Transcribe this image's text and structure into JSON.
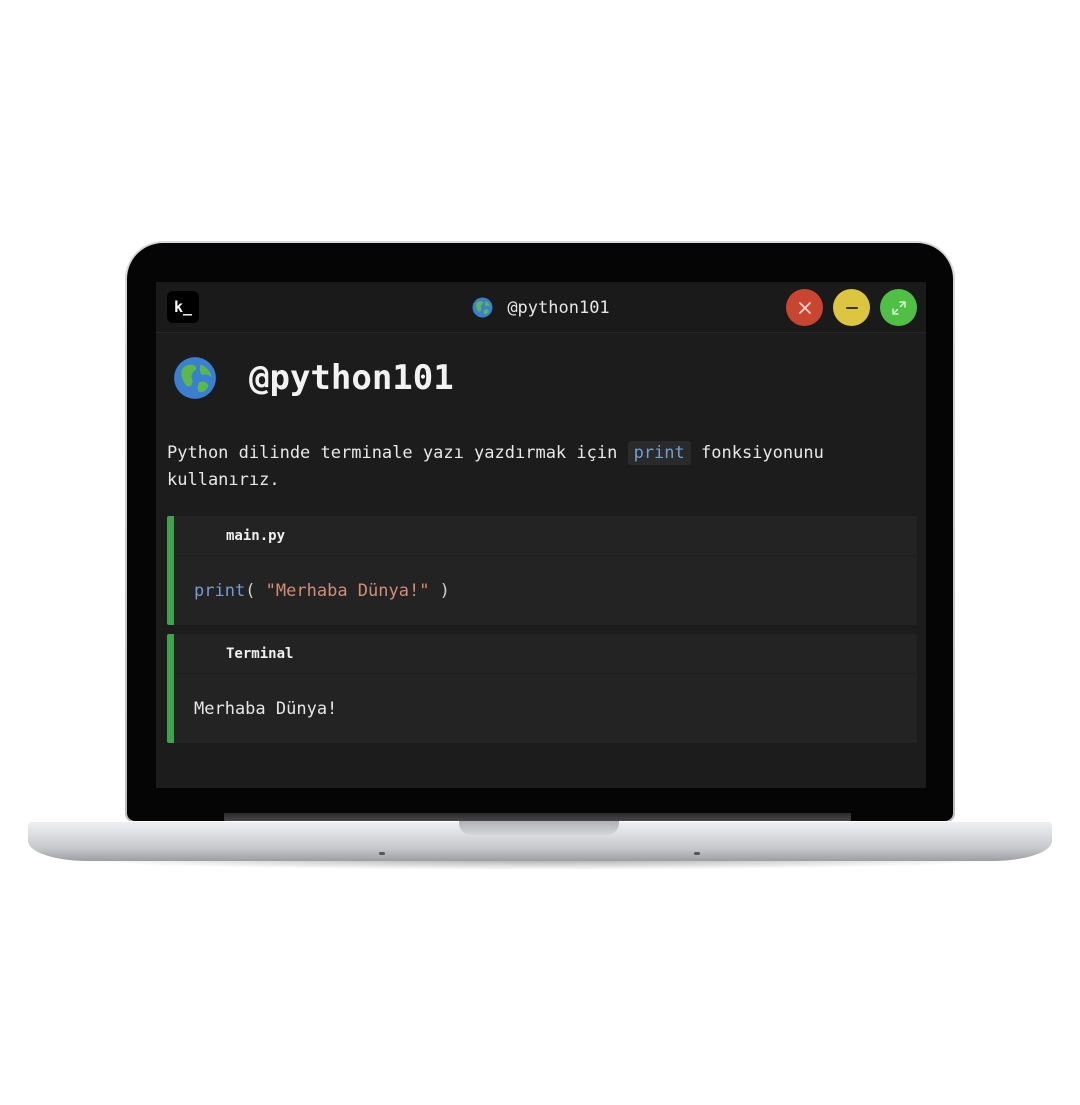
{
  "window": {
    "app_icon_label": "k_",
    "title": "@python101",
    "controls": [
      "close",
      "minimize",
      "maximize"
    ]
  },
  "page": {
    "heading": "@python101",
    "paragraph_before": "Python dilinde terminale yazı yazdırmak için ",
    "paragraph_code": "print",
    "paragraph_after": " fonksiyonunu kullanırız."
  },
  "code_block": {
    "filename": "main.py",
    "func": "print",
    "open_paren": "( ",
    "string": "\"Merhaba Dünya!\"",
    "close_paren": " )"
  },
  "terminal_block": {
    "title": "Terminal",
    "output": "Merhaba Dünya!"
  },
  "colors": {
    "accent_green": "#3fa34d",
    "keyword_blue": "#6f9fd0",
    "string_orange": "#d08f73",
    "close_red": "#c9452f",
    "minimize_yellow": "#dcc53f",
    "maximize_green": "#4fbf45"
  },
  "icons": {
    "app": "terminal-app-icon",
    "title_emoji": "globe-icon",
    "heading_emoji": "globe-icon"
  }
}
